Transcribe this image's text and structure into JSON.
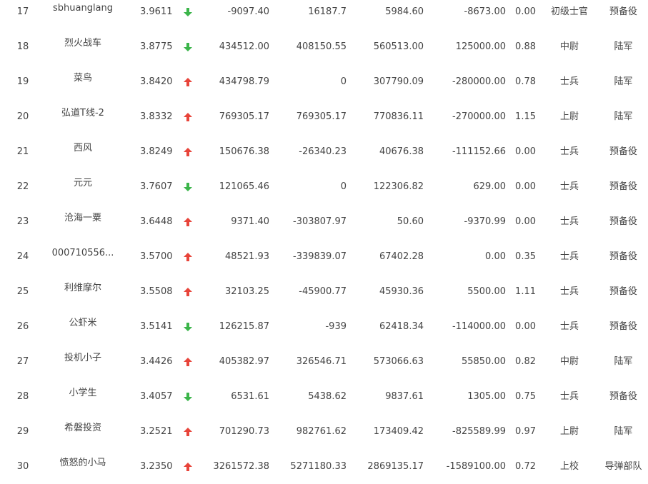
{
  "colors": {
    "up": "#e8443a",
    "down": "#3bb54a",
    "text": "#444444"
  },
  "rows": [
    {
      "rank": "17",
      "name": "sbhuanglang",
      "score": "3.9611",
      "trend": "down",
      "v1": "-9097.40",
      "v2": "16187.7",
      "v3": "5984.60",
      "v4": "-8673.00",
      "v5": "0.00",
      "rank_title": "初级士官",
      "unit": "预备役"
    },
    {
      "rank": "18",
      "name": "烈火战车",
      "score": "3.8775",
      "trend": "down",
      "v1": "434512.00",
      "v2": "408150.55",
      "v3": "560513.00",
      "v4": "125000.00",
      "v5": "0.88",
      "rank_title": "中尉",
      "unit": "陆军"
    },
    {
      "rank": "19",
      "name": "菜鸟",
      "score": "3.8420",
      "trend": "up",
      "v1": "434798.79",
      "v2": "0",
      "v3": "307790.09",
      "v4": "-280000.00",
      "v5": "0.78",
      "rank_title": "士兵",
      "unit": "陆军"
    },
    {
      "rank": "20",
      "name": "弘道T线-2",
      "score": "3.8332",
      "trend": "up",
      "v1": "769305.17",
      "v2": "769305.17",
      "v3": "770836.11",
      "v4": "-270000.00",
      "v5": "1.15",
      "rank_title": "上尉",
      "unit": "陆军"
    },
    {
      "rank": "21",
      "name": "西风",
      "score": "3.8249",
      "trend": "up",
      "v1": "150676.38",
      "v2": "-26340.23",
      "v3": "40676.38",
      "v4": "-111152.66",
      "v5": "0.00",
      "rank_title": "士兵",
      "unit": "预备役"
    },
    {
      "rank": "22",
      "name": "元元",
      "score": "3.7607",
      "trend": "down",
      "v1": "121065.46",
      "v2": "0",
      "v3": "122306.82",
      "v4": "629.00",
      "v5": "0.00",
      "rank_title": "士兵",
      "unit": "预备役"
    },
    {
      "rank": "23",
      "name": "沧海一粟",
      "score": "3.6448",
      "trend": "up",
      "v1": "9371.40",
      "v2": "-303807.97",
      "v3": "50.60",
      "v4": "-9370.99",
      "v5": "0.00",
      "rank_title": "士兵",
      "unit": "预备役"
    },
    {
      "rank": "24",
      "name": "000710556...",
      "score": "3.5700",
      "trend": "up",
      "v1": "48521.93",
      "v2": "-339839.07",
      "v3": "67402.28",
      "v4": "0.00",
      "v5": "0.35",
      "rank_title": "士兵",
      "unit": "预备役"
    },
    {
      "rank": "25",
      "name": "利维摩尔",
      "score": "3.5508",
      "trend": "up",
      "v1": "32103.25",
      "v2": "-45900.77",
      "v3": "45930.36",
      "v4": "5500.00",
      "v5": "1.11",
      "rank_title": "士兵",
      "unit": "预备役"
    },
    {
      "rank": "26",
      "name": "公虾米",
      "score": "3.5141",
      "trend": "down",
      "v1": "126215.87",
      "v2": "-939",
      "v3": "62418.34",
      "v4": "-114000.00",
      "v5": "0.00",
      "rank_title": "士兵",
      "unit": "预备役"
    },
    {
      "rank": "27",
      "name": "投机小子",
      "score": "3.4426",
      "trend": "up",
      "v1": "405382.97",
      "v2": "326546.71",
      "v3": "573066.63",
      "v4": "55850.00",
      "v5": "0.82",
      "rank_title": "中尉",
      "unit": "陆军"
    },
    {
      "rank": "28",
      "name": "小学生",
      "score": "3.4057",
      "trend": "down",
      "v1": "6531.61",
      "v2": "5438.62",
      "v3": "9837.61",
      "v4": "1305.00",
      "v5": "0.75",
      "rank_title": "士兵",
      "unit": "预备役"
    },
    {
      "rank": "29",
      "name": "希磐投资",
      "score": "3.2521",
      "trend": "up",
      "v1": "701290.73",
      "v2": "982761.62",
      "v3": "173409.42",
      "v4": "-825589.99",
      "v5": "0.97",
      "rank_title": "上尉",
      "unit": "陆军"
    },
    {
      "rank": "30",
      "name": "愤怒的小马",
      "score": "3.2350",
      "trend": "up",
      "v1": "3261572.38",
      "v2": "5271180.33",
      "v3": "2869135.17",
      "v4": "-1589100.00",
      "v5": "0.72",
      "rank_title": "上校",
      "unit": "导弹部队"
    }
  ]
}
